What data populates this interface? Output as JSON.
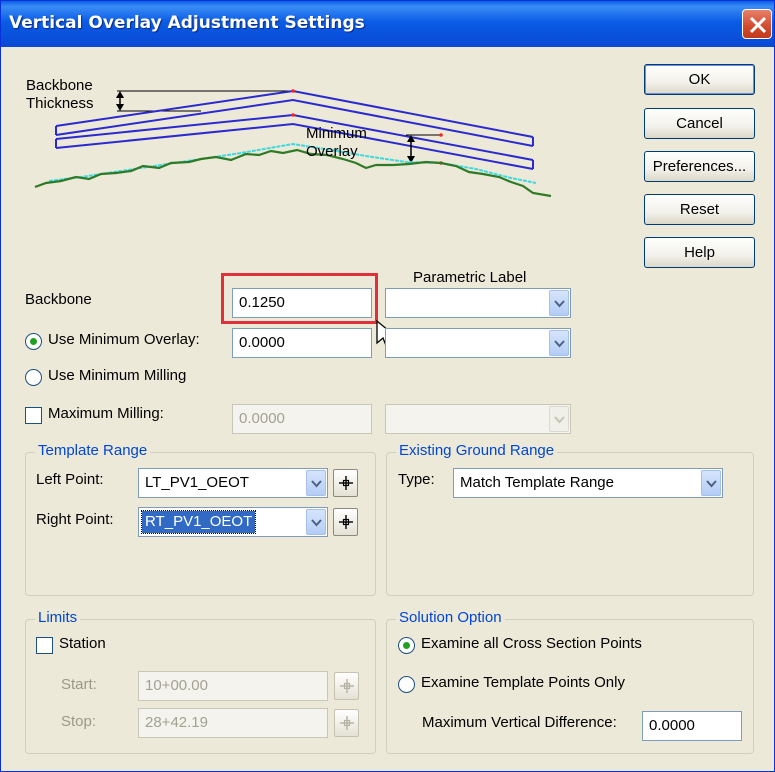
{
  "window": {
    "title": "Vertical Overlay Adjustment Settings"
  },
  "buttons": {
    "ok": "OK",
    "cancel": "Cancel",
    "preferences": "Preferences...",
    "reset": "Reset",
    "help": "Help"
  },
  "diagram": {
    "backbone_thickness_line1": "Backbone",
    "backbone_thickness_line2": "Thickness",
    "minimum_overlay_line1": "Minimum",
    "minimum_overlay_line2": "Overlay"
  },
  "form": {
    "parametric_label_header": "Parametric Label",
    "backbone_label": "Backbone",
    "backbone_value": "0.1250",
    "use_min_overlay_label": "Use Minimum Overlay:",
    "min_overlay_value": "0.0000",
    "use_min_milling_label": "Use Minimum Milling",
    "max_milling_label": "Maximum Milling:",
    "max_milling_value": "0.0000"
  },
  "template_range": {
    "title": "Template Range",
    "left_label": "Left Point:",
    "left_value": "LT_PV1_OEOT",
    "right_label": "Right Point:",
    "right_value": "RT_PV1_OEOT"
  },
  "existing_ground": {
    "title": "Existing Ground Range",
    "type_label": "Type:",
    "type_value": "Match Template Range"
  },
  "limits": {
    "title": "Limits",
    "station_label": "Station",
    "start_label": "Start:",
    "start_value": "10+00.00",
    "stop_label": "Stop:",
    "stop_value": "28+42.19"
  },
  "solution": {
    "title": "Solution Option",
    "opt1": "Examine all Cross Section Points",
    "opt2": "Examine Template Points Only",
    "max_vert_label": "Maximum Vertical Difference:",
    "max_vert_value": "0.0000"
  },
  "colors": {
    "titlebar": "#0a5fe8",
    "backbone": "#2a2ad0",
    "overlay": "#40d8e0",
    "ground": "#2e7a26",
    "highlight": "#e0303a"
  }
}
